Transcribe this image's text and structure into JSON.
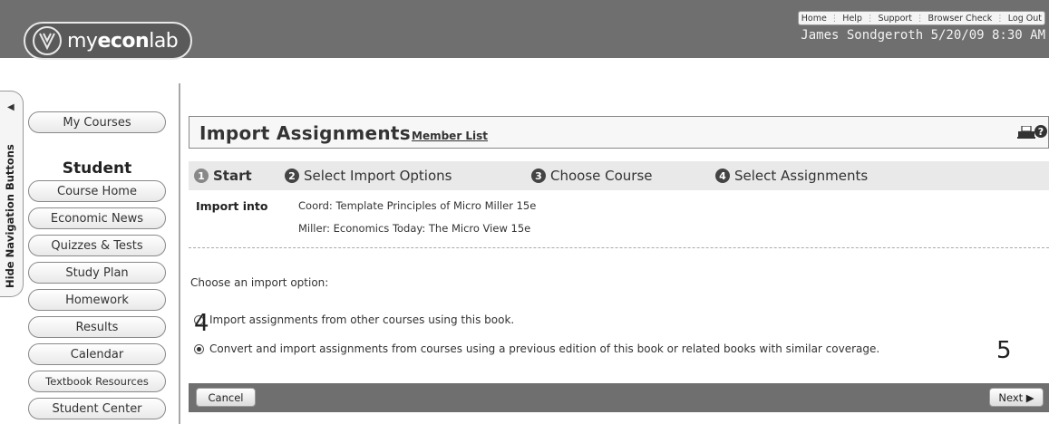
{
  "header": {
    "logo_prefix": "my",
    "logo_bold": "econ",
    "logo_suffix": "lab",
    "top_links": [
      "Home",
      "Help",
      "Support",
      "Browser Check",
      "Log Out"
    ],
    "user_line": "James Sondgeroth 5/20/09 8:30 AM"
  },
  "sidebar": {
    "hide_label": "Hide Navigation Buttons",
    "my_courses": "My Courses",
    "section_title": "Student",
    "items": [
      {
        "label": "Course Home"
      },
      {
        "label": "Economic News"
      },
      {
        "label": "Quizzes & Tests"
      },
      {
        "label": "Study Plan"
      },
      {
        "label": "Homework"
      },
      {
        "label": "Results"
      },
      {
        "label": "Calendar"
      },
      {
        "label": "Textbook Resources"
      },
      {
        "label": "Student Center"
      }
    ]
  },
  "main": {
    "title": "Import Assignments",
    "member_link": "Member List",
    "steps": [
      {
        "num": "1",
        "label": "Start"
      },
      {
        "num": "2",
        "label": "Select Import Options"
      },
      {
        "num": "3",
        "label": "Choose Course"
      },
      {
        "num": "4",
        "label": "Select Assignments"
      }
    ],
    "import_into_label": "Import into",
    "import_into_lines": [
      "Coord: Template Principles of Micro Miller 15e",
      "Miller: Economics Today: The Micro View 15e"
    ],
    "choose_prompt": "Choose an import option:",
    "options": [
      {
        "label": "Import assignments from other courses using this book.",
        "selected": false
      },
      {
        "label": "Convert and import assignments from courses using a previous edition of this book or related books with similar coverage.",
        "selected": true
      }
    ],
    "callout_4": "4",
    "callout_5": "5",
    "cancel_label": "Cancel",
    "next_label": "Next ▶"
  }
}
